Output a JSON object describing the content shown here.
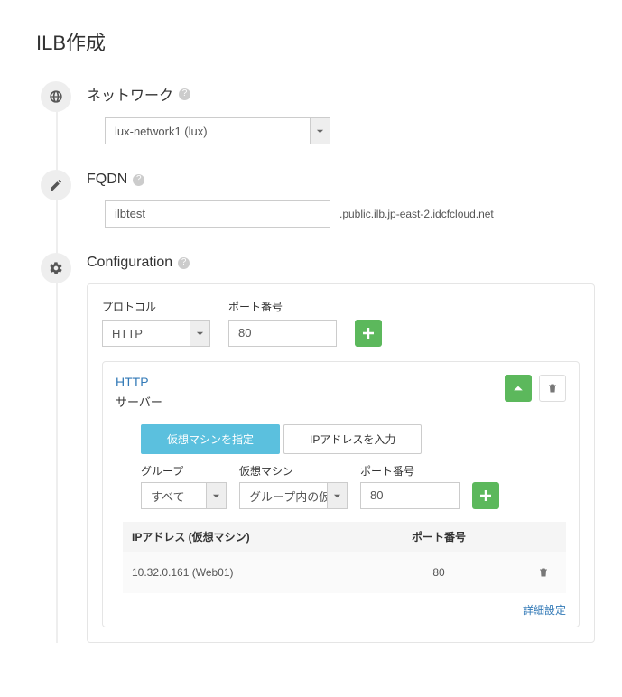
{
  "page_title": "ILB作成",
  "sections": {
    "network": {
      "title": "ネットワーク",
      "selected": "lux-network1 (lux)"
    },
    "fqdn": {
      "title": "FQDN",
      "value": "ilbtest",
      "suffix": ".public.ilb.jp-east-2.idcfcloud.net"
    },
    "configuration": {
      "title": "Configuration",
      "protocol_label": "プロトコル",
      "port_label": "ポート番号",
      "protocol_value": "HTTP",
      "port_value": "80",
      "entry": {
        "title": "HTTP",
        "server_heading": "サーバー",
        "tabs": {
          "vm": "仮想マシンを指定",
          "ip": "IPアドレスを入力"
        },
        "fields": {
          "group_label": "グループ",
          "group_value": "すべて",
          "vm_label": "仮想マシン",
          "vm_value": "グループ内の仮想マシン",
          "port_label": "ポート番号",
          "port_value": "80"
        },
        "table": {
          "col_ip": "IPアドレス (仮想マシン)",
          "col_port": "ポート番号",
          "rows": [
            {
              "ip": "10.32.0.161 (Web01)",
              "port": "80"
            }
          ]
        },
        "advanced_label": "詳細設定"
      }
    }
  }
}
